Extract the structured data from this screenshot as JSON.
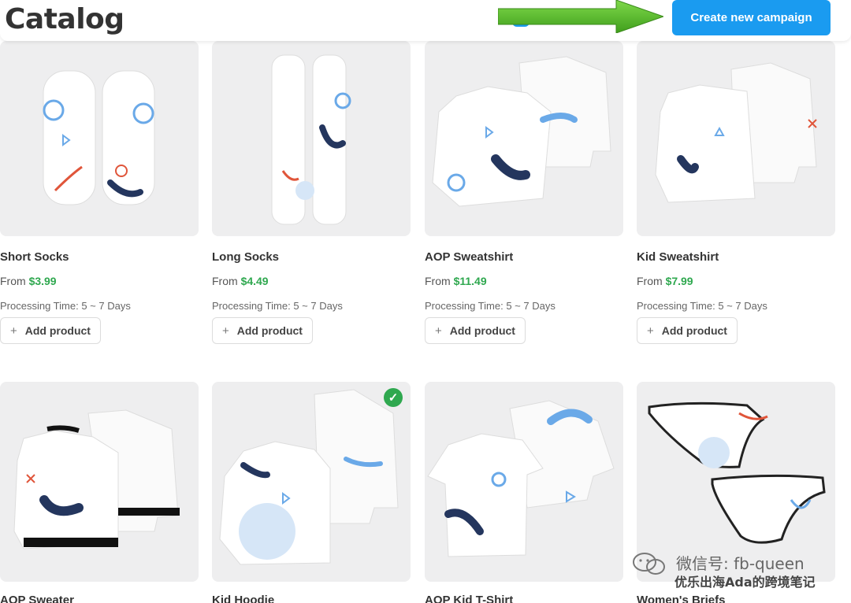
{
  "header": {
    "title": "Catalog",
    "cta_label": "Create new campaign",
    "accent_color": "#1a9bf0",
    "arrow_color": "#5cbf2a"
  },
  "products": [
    {
      "name": "Short Socks",
      "price_prefix": "From ",
      "price": "$3.99",
      "processing": "Processing Time: 5 ~ 7 Days",
      "add_label": "Add product",
      "icon": "socks-short-image",
      "selected": false
    },
    {
      "name": "Long Socks",
      "price_prefix": "From ",
      "price": "$4.49",
      "processing": "Processing Time: 5 ~ 7 Days",
      "add_label": "Add product",
      "icon": "socks-long-image",
      "selected": false
    },
    {
      "name": "AOP Sweatshirt",
      "price_prefix": "From ",
      "price": "$11.49",
      "processing": "Processing Time: 5 ~ 7 Days",
      "add_label": "Add product",
      "icon": "sweatshirt-image",
      "selected": false
    },
    {
      "name": "Kid Sweatshirt",
      "price_prefix": "From ",
      "price": "$7.99",
      "processing": "Processing Time: 5 ~ 7 Days",
      "add_label": "Add product",
      "icon": "kid-sweatshirt-image",
      "selected": false
    },
    {
      "name": "AOP Sweater",
      "icon": "sweater-image",
      "selected": false
    },
    {
      "name": "Kid Hoodie",
      "icon": "hoodie-image",
      "selected": true
    },
    {
      "name": "AOP Kid T-Shirt",
      "icon": "tshirt-image",
      "selected": false
    },
    {
      "name": "Women's Briefs",
      "icon": "briefs-image",
      "selected": false
    }
  ],
  "watermark": {
    "line1": "微信号: fb-queen",
    "line2": "优乐出海Ada的跨境笔记"
  }
}
